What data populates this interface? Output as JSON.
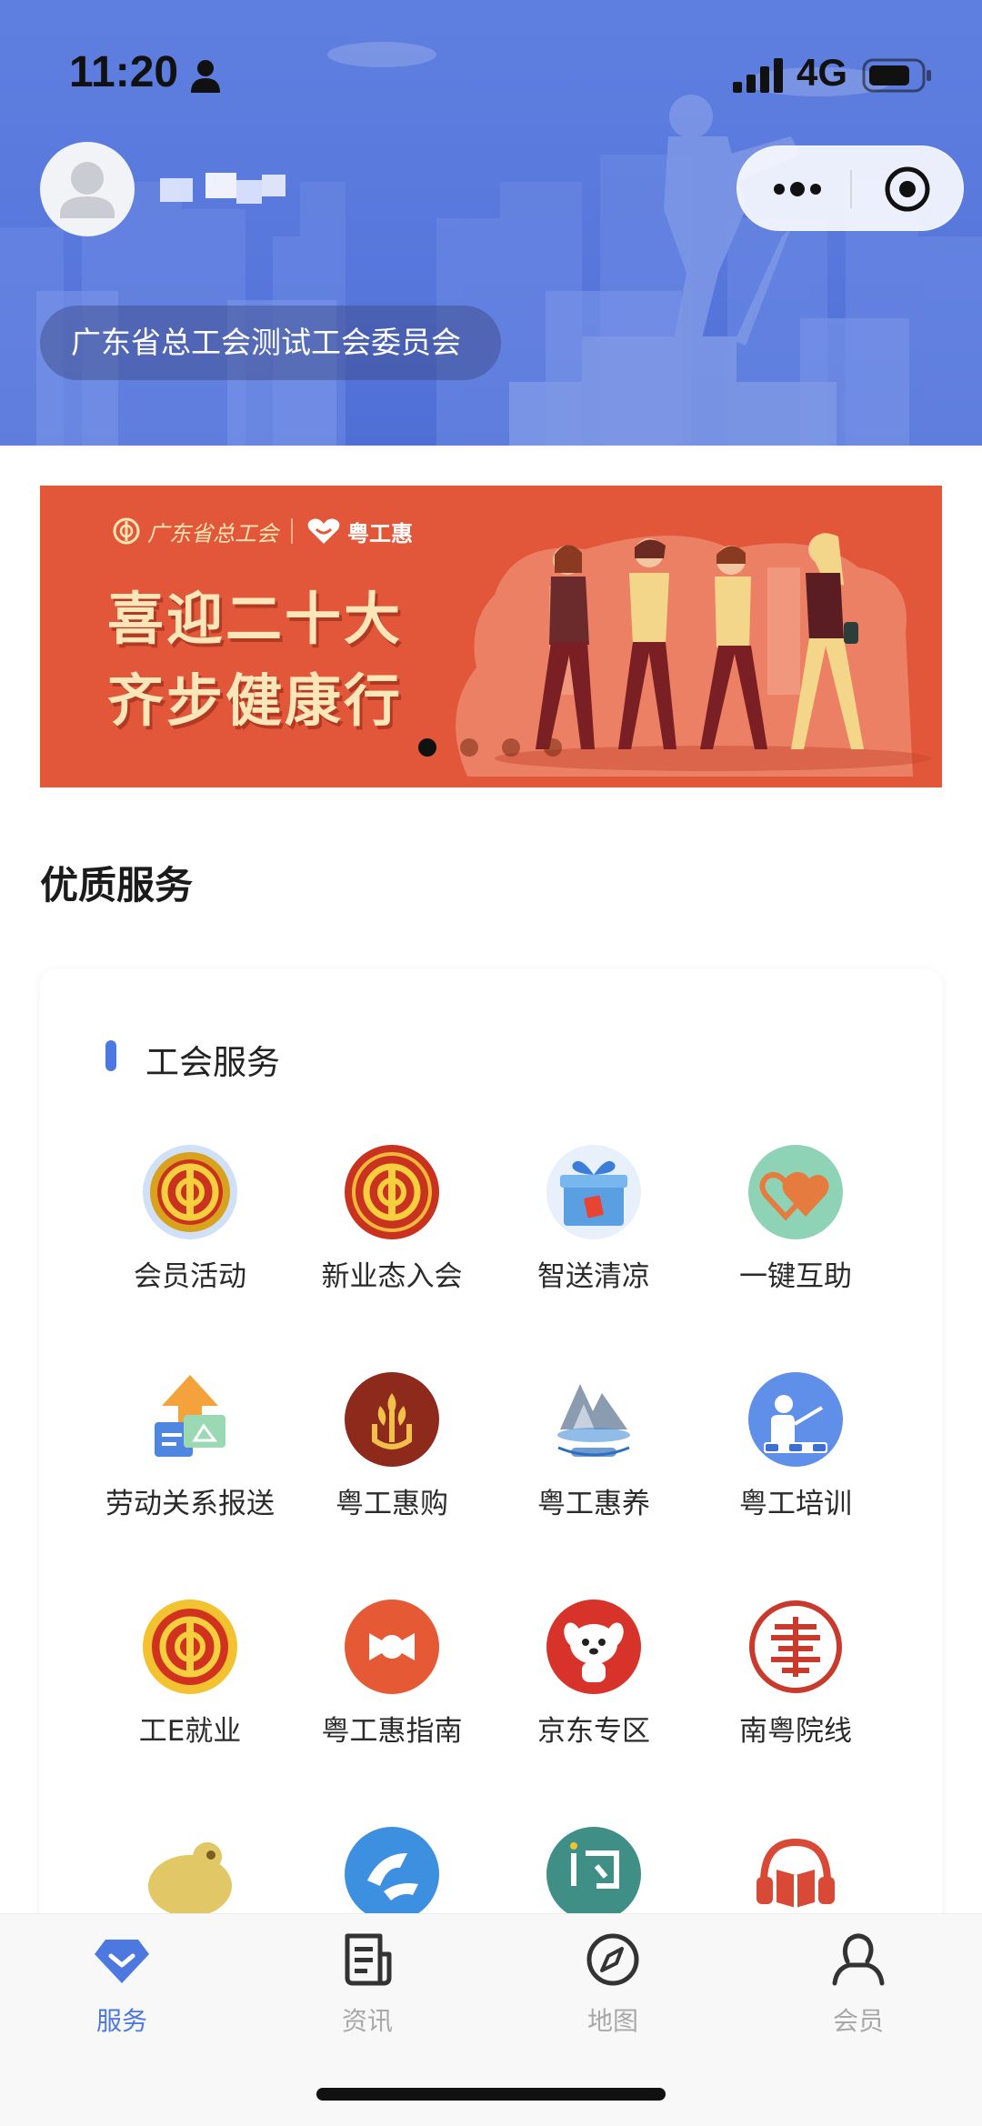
{
  "status_bar": {
    "time": "11:20",
    "network": "4G"
  },
  "header": {
    "user_name": "",
    "organization": "广东省总工会测试工会委员会"
  },
  "banner": {
    "logo_left": "广东省总工会",
    "logo_right": "粤工惠",
    "headline_line1": "喜迎二十大",
    "headline_line2": "齐步健康行",
    "slide_count": 4,
    "active_slide": 1
  },
  "section": {
    "title": "优质服务"
  },
  "card": {
    "title": "工会服务",
    "services": [
      {
        "label": "会员活动",
        "icon": "union-emblem-light-icon"
      },
      {
        "label": "新业态入会",
        "icon": "union-emblem-red-icon"
      },
      {
        "label": "智送清凉",
        "icon": "gift-box-icon"
      },
      {
        "label": "一键互助",
        "icon": "double-heart-icon"
      },
      {
        "label": "劳动关系报送",
        "icon": "upload-report-icon"
      },
      {
        "label": "粤工惠购",
        "icon": "wheat-hand-icon"
      },
      {
        "label": "粤工惠养",
        "icon": "mountain-rest-icon"
      },
      {
        "label": "粤工培训",
        "icon": "training-icon"
      },
      {
        "label": "工E就业",
        "icon": "union-emblem-gold-icon"
      },
      {
        "label": "粤工惠指南",
        "icon": "candy-guide-icon"
      },
      {
        "label": "京东专区",
        "icon": "jd-dog-icon"
      },
      {
        "label": "南粤院线",
        "icon": "cinema-seal-icon"
      },
      {
        "label": "",
        "icon": "frog-icon"
      },
      {
        "label": "",
        "icon": "runner-icon"
      },
      {
        "label": "",
        "icon": "q-badge-icon"
      },
      {
        "label": "",
        "icon": "audiobook-icon"
      }
    ]
  },
  "tabbar": {
    "tabs": [
      {
        "label": "服务",
        "icon": "diamond-icon",
        "active": true
      },
      {
        "label": "资讯",
        "icon": "news-icon",
        "active": false
      },
      {
        "label": "地图",
        "icon": "compass-icon",
        "active": false
      },
      {
        "label": "会员",
        "icon": "user-icon",
        "active": false
      }
    ]
  },
  "colors": {
    "header_bg": "#5f7fe0",
    "banner_bg": "#e2573a",
    "accent": "#4d78e0",
    "tab_inactive": "#a8a8a8"
  }
}
